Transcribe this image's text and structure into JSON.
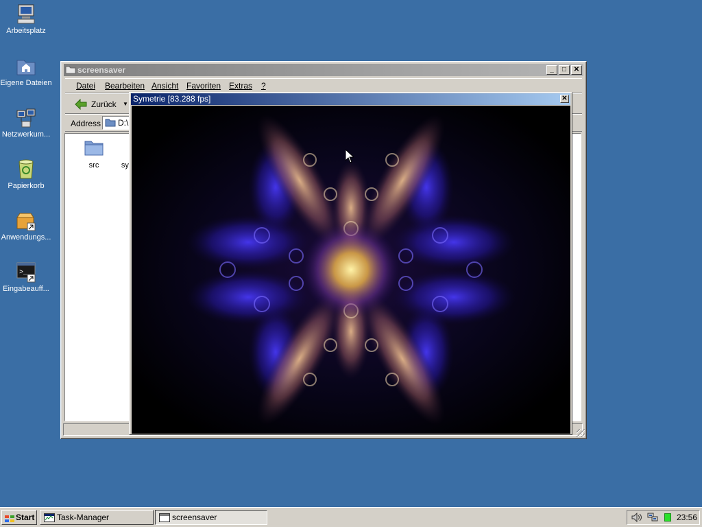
{
  "desktop": {
    "icons": [
      {
        "label": "Arbeitsplatz",
        "icon": "computer-icon"
      },
      {
        "label": "Eigene Dateien",
        "icon": "documents-folder-icon"
      },
      {
        "label": "Netzwerkum...",
        "icon": "network-icon"
      },
      {
        "label": "Papierkorb",
        "icon": "recycle-bin-icon"
      },
      {
        "label": "Anwendungs...",
        "icon": "application-shortcut-icon"
      },
      {
        "label": "Eingabeauff...",
        "icon": "command-prompt-icon"
      }
    ]
  },
  "explorer": {
    "title": "screensaver",
    "menu": [
      "Datei",
      "Bearbeiten",
      "Ansicht",
      "Favoriten",
      "Extras",
      "?"
    ],
    "toolbar": {
      "back_label": "Zurück"
    },
    "address": {
      "label": "Address",
      "value": "D:\\"
    },
    "files": [
      {
        "name": "src",
        "icon": "folder-icon"
      },
      {
        "name": "sym",
        "icon": "file-icon"
      }
    ]
  },
  "screensaver_window": {
    "title": "Symetrie [83.288 fps]"
  },
  "taskbar": {
    "start_label": "Start",
    "tasks": [
      {
        "label": "Task-Manager",
        "icon": "task-manager-icon",
        "active": false
      },
      {
        "label": "screensaver",
        "icon": "window-icon",
        "active": true
      }
    ],
    "clock": "23:56"
  },
  "colors": {
    "desktop": "#3a6ea5",
    "active_title": "#0a246a",
    "window_face": "#d4d0c8"
  }
}
